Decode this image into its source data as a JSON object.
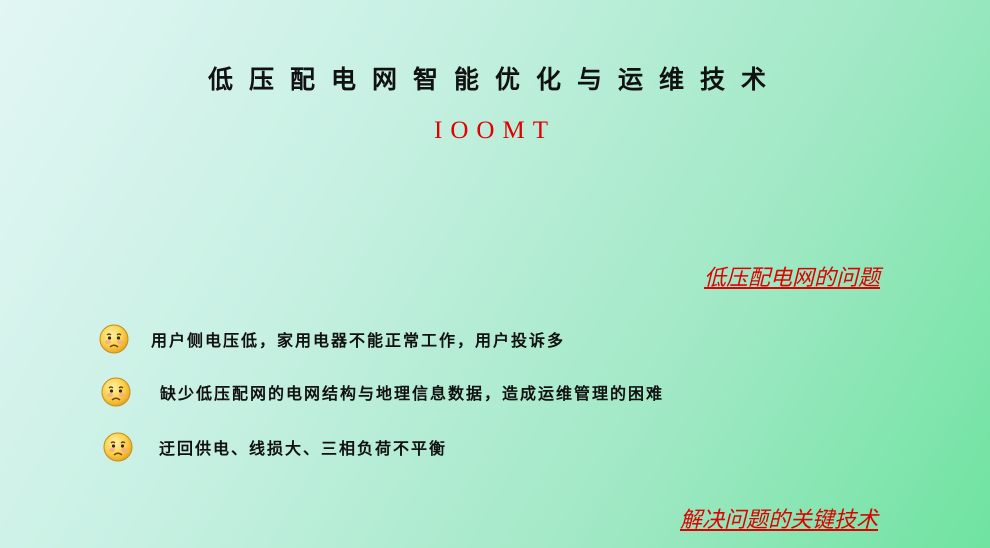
{
  "slide": {
    "title": "低压配电网智能优化与运维技术",
    "subtitle": "IOOMT",
    "problems_heading": "低压配电网的问题",
    "problems": [
      "用户侧电压低，家用电器不能正常工作，用户投诉多",
      "缺少低压配网的电网结构与地理信息数据，造成运维管理的困难",
      "迂回供电、线损大、三相负荷不平衡"
    ],
    "solutions_heading": "解决问题的关键技术"
  },
  "colors": {
    "accent_red": "#e00000",
    "text_dark": "#111111",
    "bg_light": "#e2f6f4",
    "bg_green": "#6fe3a0",
    "face_yellow": "#fbd34a"
  },
  "icons": {
    "bullet": "sad-face-icon"
  }
}
